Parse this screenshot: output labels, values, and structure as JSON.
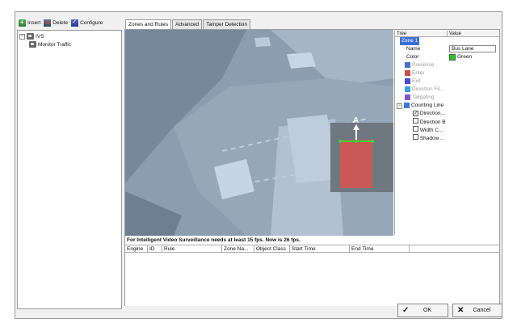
{
  "toolbar": {
    "insert_label": "Insert",
    "delete_label": "Delete",
    "configure_label": "Configure"
  },
  "tree": {
    "root_label": "IVS",
    "child_label": "Monitor Traffic"
  },
  "tabs": [
    {
      "label": "Zones and Rules"
    },
    {
      "label": "Advanced"
    },
    {
      "label": "Tamper Detection"
    }
  ],
  "video": {
    "direction_label": "A"
  },
  "property_grid": {
    "col_tree": "Tree",
    "col_value": "Value",
    "zone_label": "Zone 1",
    "name_label": "Name",
    "name_value": "Bus Lane",
    "color_label": "Color",
    "color_value": "Green",
    "color_hex": "#22cc22",
    "presence_label": "Presence",
    "enter_label": "Enter",
    "exit_label": "Exit",
    "direction_filter_label": "Direction Fil...",
    "tailgating_label": "Tailgating",
    "counting_line_label": "Counting Line",
    "direction_a_label": "Direction...",
    "direction_b_label": "Direction B",
    "width_label": "Width C...",
    "shadow_label": "Shadow ..."
  },
  "status_text": "For Intelligent Video Surveillance needs at least 15 fps. Now is 26 fps.",
  "events": {
    "columns": [
      "Engine",
      "ID",
      "Rule",
      "Zone Na...",
      "Object Class",
      "Start Time",
      "End Time"
    ]
  },
  "buttons": {
    "ok_label": "OK",
    "cancel_label": "Cancel"
  }
}
